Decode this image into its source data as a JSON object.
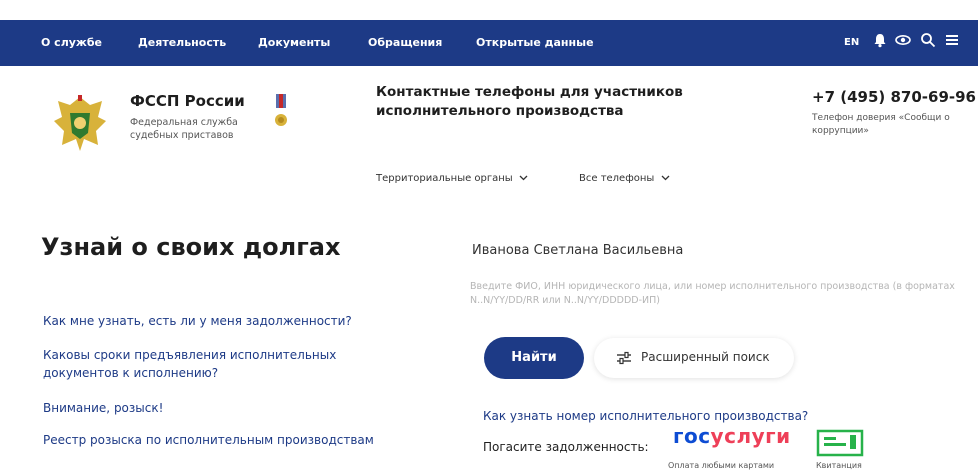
{
  "nav": {
    "items": [
      "О службе",
      "Деятельность",
      "Документы",
      "Обращения",
      "Открытые данные"
    ],
    "lang": "EN",
    "icons": [
      "bell-icon",
      "eye-icon",
      "search-icon",
      "menu-icon"
    ]
  },
  "header": {
    "org_name": "ФССП России",
    "org_sub": "Федеральная служба судебных приставов",
    "contact_title": "Контактные телефоны для участников исполнительного производства",
    "dropdown_regions": "Территориальные органы",
    "dropdown_phones": "Все телефоны",
    "phone": "+7 (495) 870-69-96",
    "phone_sub": "Телефон доверия «Сообщи о коррупции»"
  },
  "main": {
    "title": "Узнай о своих долгах",
    "faq": [
      "Как мне узнать, есть ли у меня задолженности?",
      "Каковы сроки предъявления исполнительных документов к исполнению?",
      "Внимание, розыск!",
      "Реестр розыска по исполнительным производствам"
    ]
  },
  "search": {
    "value": "Иванова Светлана Васильевна",
    "help": "Введите ФИО, ИНН юридического лица, или номер исполнительного производства (в форматах N..N/YY/DD/RR или N..N/YY/DDDDD-ИП)",
    "find_label": "Найти",
    "advanced_label": "Расширенный поиск"
  },
  "payment": {
    "how_link": "Как узнать номер исполнительного производства?",
    "pay_label": "Погасите задолженность:",
    "gosuslugi_a": "гос",
    "gosuslugi_b": "услуги",
    "gosuslugi_caption": "Оплата любыми картами",
    "receipt_caption": "Квитанция"
  },
  "colors": {
    "nav_bg": "#1d3a86",
    "link": "#1d3a86",
    "gos_blue": "#0d4cd3",
    "gos_red": "#ee3f58",
    "receipt_green": "#27b24a"
  }
}
